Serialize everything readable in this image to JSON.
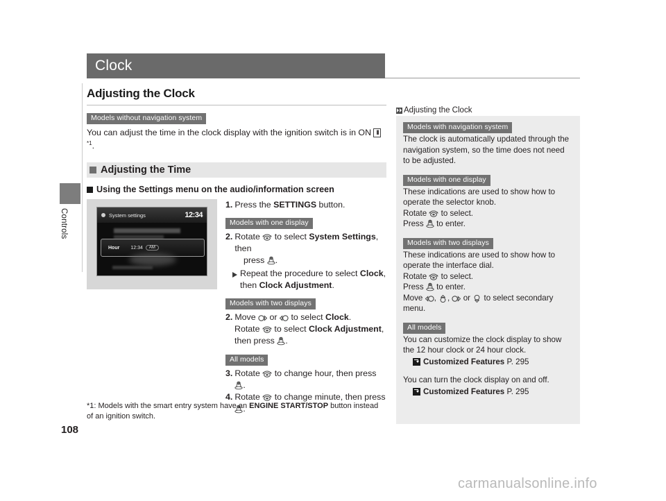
{
  "document": {
    "header_title": "Clock",
    "section_title": "Adjusting the Clock",
    "page_number": "108",
    "side_tab_label": "Controls",
    "watermark": "carmanualsonline.info"
  },
  "intro": {
    "chip": "Models without navigation system",
    "text_before": "You can adjust the time in the clock display with the ignition switch is in ON ",
    "on_icon": "II",
    "footnote_marker": "*1",
    "text_after": "."
  },
  "subhead": {
    "label": "Adjusting the Time"
  },
  "subsub": {
    "label": "Using the Settings menu on the audio/information screen"
  },
  "figure": {
    "screen_title": "System settings",
    "screen_clock": "12:34",
    "row_label": "Hour",
    "row_value": "12:34",
    "row_unit": "AM"
  },
  "steps": {
    "step1": {
      "num": "1.",
      "text_before": "Press the ",
      "bold": "SETTINGS",
      "text_after": " button."
    },
    "chip_one_display": "Models with one display",
    "step2_one": {
      "num": "2.",
      "t1": "Rotate ",
      "icon1": "rotate-knob-icon",
      "t2": " to select ",
      "b1": "System Settings",
      "t3": ", then",
      "line2_t1": "press ",
      "icon2": "press-knob-icon",
      "line2_t2": "."
    },
    "step2_one_bullet": {
      "t1": "Repeat the procedure to select ",
      "b1": "Clock",
      "t2": ",",
      "line2_t1": "then ",
      "b2": "Clock Adjustment",
      "line2_t2": "."
    },
    "chip_two_displays": "Models with two displays",
    "step2_two": {
      "num": "2.",
      "t1": "Move ",
      "icon1": "move-right-icon",
      "t2": " or ",
      "icon2": "move-left-icon",
      "t3": " to select ",
      "b1": "Clock",
      "t4": ".",
      "line2_t1": "Rotate ",
      "icon3": "rotate-knob-icon",
      "line2_t2": " to select ",
      "b2": "Clock Adjustment",
      "line2_t3": ",",
      "line3_t1": "then press ",
      "icon4": "press-knob-icon",
      "line3_t2": "."
    },
    "chip_all_models": "All models",
    "step3": {
      "num": "3.",
      "t1": "Rotate ",
      "icon1": "rotate-knob-icon",
      "t2": " to change hour, then press ",
      "icon2": "press-knob-icon",
      "t3": "."
    },
    "step4": {
      "num": "4.",
      "t1": "Rotate ",
      "icon1": "rotate-knob-icon",
      "t2": " to change minute, then press ",
      "icon2": "press-knob-icon",
      "t3": "."
    }
  },
  "footnote": {
    "t1": "*1: Models with the smart entry system have an ",
    "b1": "ENGINE START/STOP",
    "t2": " button instead of an ignition switch."
  },
  "sidebar": {
    "heading": "Adjusting the Clock",
    "blocks": [
      {
        "chip": "Models with navigation system",
        "text": "The clock is automatically updated through the navigation system, so the time does not need to be adjusted."
      },
      {
        "chip": "Models with one display",
        "line1": "These indications are used to show how to operate the selector knob.",
        "line2_t1": "Rotate ",
        "line2_icon": "rotate-knob-icon",
        "line2_t2": " to select.",
        "line3_t1": "Press ",
        "line3_icon": "press-knob-icon",
        "line3_t2": " to enter."
      },
      {
        "chip": "Models with two displays",
        "line1": "These indications are used to show how to operate the interface dial.",
        "line2_t1": "Rotate ",
        "line2_icon": "rotate-knob-icon",
        "line2_t2": " to select.",
        "line3_t1": "Press ",
        "line3_icon": "press-knob-icon",
        "line3_t2": " to enter.",
        "line4_t1": "Move ",
        "line4_icons": [
          "move-left-icon",
          "move-up-icon",
          "move-right-icon",
          "move-down-icon"
        ],
        "line4_t2": " to select secondary menu."
      },
      {
        "chip": "All models",
        "para1": "You can customize the clock display to show the 12 hour clock or 24 hour clock.",
        "ref1_bold": "Customized Features",
        "ref1_page": " P. 295",
        "para2": "You can turn the clock display on and off.",
        "ref2_bold": "Customized Features",
        "ref2_page": " P. 295"
      }
    ]
  }
}
